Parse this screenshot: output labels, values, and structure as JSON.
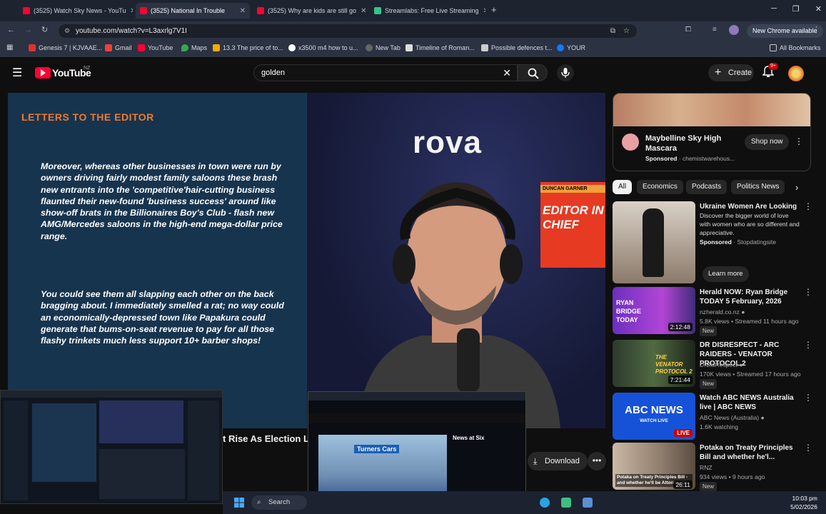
{
  "browser": {
    "tabs": [
      {
        "title": "(3525) Watch Sky News - YouTu",
        "active": false
      },
      {
        "title": "(3525) National In Trouble",
        "active": true
      },
      {
        "title": "(3525) Why are kids are still go",
        "active": false
      },
      {
        "title": "Streamlabs: Free Live Streaming",
        "active": false
      }
    ],
    "url": "youtube.com/watch?v=L3axrlg7V1I",
    "new_chrome": "New Chrome available",
    "bookmarks": [
      "Genesis 7 | KJVAAE...",
      "Gmail",
      "YouTube",
      "Maps",
      "13.3 The price of to...",
      "x3500 m4 how to u...",
      "New Tab",
      "Timeline of Roman...",
      "Possible defences t...",
      "YOUR"
    ],
    "all_bookmarks": "All Bookmarks"
  },
  "youtube": {
    "logo_region": "NZ",
    "search_value": "golden",
    "create_label": "Create",
    "notif_count": "9+"
  },
  "video": {
    "letters_title": "LETTERS TO THE EDITOR",
    "paragraph1": "Moreover, whereas other businesses in town were run by owners driving fairly modest family saloons these brash new entrants into the 'competitive'hair-cutting business flaunted their new-found 'business success' around like show-off brats in the Billionaires Boy's Club - flash new AMG/Mercedes saloons in the high-end mega-dollar price range.",
    "paragraph2": "You could see them all slapping each other on the back bragging about. I immediately smelled a rat; no way could an economically-depressed town like Papakura could generate that bums-on-seat revenue to pay for all those flashy trinkets much less support 10+ barber shops!",
    "studio_brand": "rova",
    "banner_name": "DUNCAN GARNER",
    "banner_text": "EDITOR IN CHIEF",
    "title_partial": "t Rise As Election Lo",
    "download_label": "Download",
    "overlay_news": "News at Six",
    "overlay_brand": "Turners Cars"
  },
  "sidebar": {
    "ad": {
      "title": "Maybelline Sky High Mascara",
      "sponsored": "Sponsored",
      "advertiser": "chemistwarehous...",
      "cta": "Shop now"
    },
    "chips": [
      "All",
      "Economics",
      "Podcasts",
      "Politics News"
    ],
    "items": [
      {
        "title": "Ukraine Women Are Looking",
        "desc": "Discover the bigger world of love with women who are so different and appreciative.",
        "sponsored": "Sponsored",
        "advertiser": "Stopdatingsite",
        "cta": "Learn more"
      },
      {
        "title": "Herald NOW: Ryan Bridge TODAY 5 February, 2026",
        "channel": "nzherald.co.nz",
        "stats": "5.8K views • Streamed 11 hours ago",
        "badge": "New",
        "duration": "2:12:48",
        "thumb_text": "RYAN BRIDGE TODAY"
      },
      {
        "title": "DR DISRESPECT - ARC RAIDERS - VENATOR PROTOCOL 2",
        "channel": "DrDisRespect",
        "stats": "170K views • Streamed 17 hours ago",
        "badge": "New",
        "duration": "7:21:44",
        "thumb_text": "THE VENATOR PROTOCOL 2"
      },
      {
        "title": "Watch ABC NEWS Australia live | ABC NEWS",
        "channel": "ABC News (Australia)",
        "stats": "1.6K watching",
        "badge": "LIVE",
        "thumb_text": "ABC NEWS",
        "thumb_sub": "WATCH LIVE"
      },
      {
        "title": "Potaka on Treaty Principles Bill and whether he'l...",
        "channel": "RNZ",
        "stats": "934 views • 9 hours ago",
        "badge": "New",
        "duration": "26:11",
        "thumb_text": "Potaka on Treaty Principles Bill - and whether he'll be Attorney-Ge"
      }
    ]
  },
  "taskbar": {
    "search_label": "Search",
    "time": "10:03 pm",
    "date": "5/02/2026"
  }
}
